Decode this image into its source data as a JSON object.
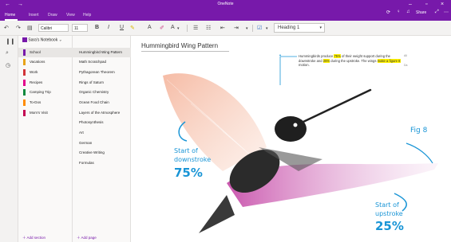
{
  "window": {
    "title": "OneNote",
    "back_icon": "arrow-left-icon",
    "forward_icon": "arrow-right-icon",
    "min_label": "–",
    "max_label": "▫",
    "close_label": "×"
  },
  "menu": {
    "items": [
      "Home",
      "Insert",
      "Draw",
      "View",
      "Help"
    ],
    "active": "Home",
    "share_label": "Share"
  },
  "ribbon": {
    "font": "Calibri",
    "size": "11",
    "bold": "B",
    "italic": "I",
    "underline": "U",
    "style": "Heading 1"
  },
  "notebook": {
    "name": "Sara's Notebook",
    "sections": [
      {
        "label": "School",
        "color": "#7719aa",
        "selected": true
      },
      {
        "label": "Vacations",
        "color": "#e8a318"
      },
      {
        "label": "Work",
        "color": "#d13438"
      },
      {
        "label": "Recipes",
        "color": "#e3008c"
      },
      {
        "label": "Camping Trip",
        "color": "#10893e"
      },
      {
        "label": "To-Dos",
        "color": "#ff8c00"
      },
      {
        "label": "Mom's Visit",
        "color": "#c30052"
      }
    ],
    "pages": [
      {
        "label": "Hummingbird Wing Pattern",
        "selected": true
      },
      {
        "label": "Math Scratchpad"
      },
      {
        "label": "Pythagorean Theorem"
      },
      {
        "label": "Rings of Saturn"
      },
      {
        "label": "Organic Chemistry"
      },
      {
        "label": "Ocean Food Chain"
      },
      {
        "label": "Layers of the Atmosphere"
      },
      {
        "label": "Photosynthesis"
      },
      {
        "label": "Art"
      },
      {
        "label": "German"
      },
      {
        "label": "Creative Writing"
      },
      {
        "label": "Formulas"
      }
    ],
    "add_section": "Add section",
    "add_page": "Add page"
  },
  "page": {
    "title": "Hummingbird Wing Pattern",
    "note_pre": "Hummingbirds produce ",
    "note_hl1": "75%",
    "note_mid": " of their weight support during the downstroke and ",
    "note_hl2": "25%",
    "note_mid2": " during the upstroke. The wings ",
    "note_hl3": "make a figure 8",
    "note_end": " motion.",
    "side_a": "All",
    "side_b": "Da",
    "ink_fig8": "Fig 8",
    "ink_start_down_1": "Start of",
    "ink_start_down_2": "downstroke",
    "ink_75": "75%",
    "ink_start_up_1": "Start of",
    "ink_start_up_2": "upstroke",
    "ink_25": "25%"
  },
  "colors": {
    "accent": "#7719aa",
    "ink": "#1a95d6",
    "highlight": "#fff200",
    "wing_down": "#f2a183",
    "wing_up": "#b52b9a"
  }
}
